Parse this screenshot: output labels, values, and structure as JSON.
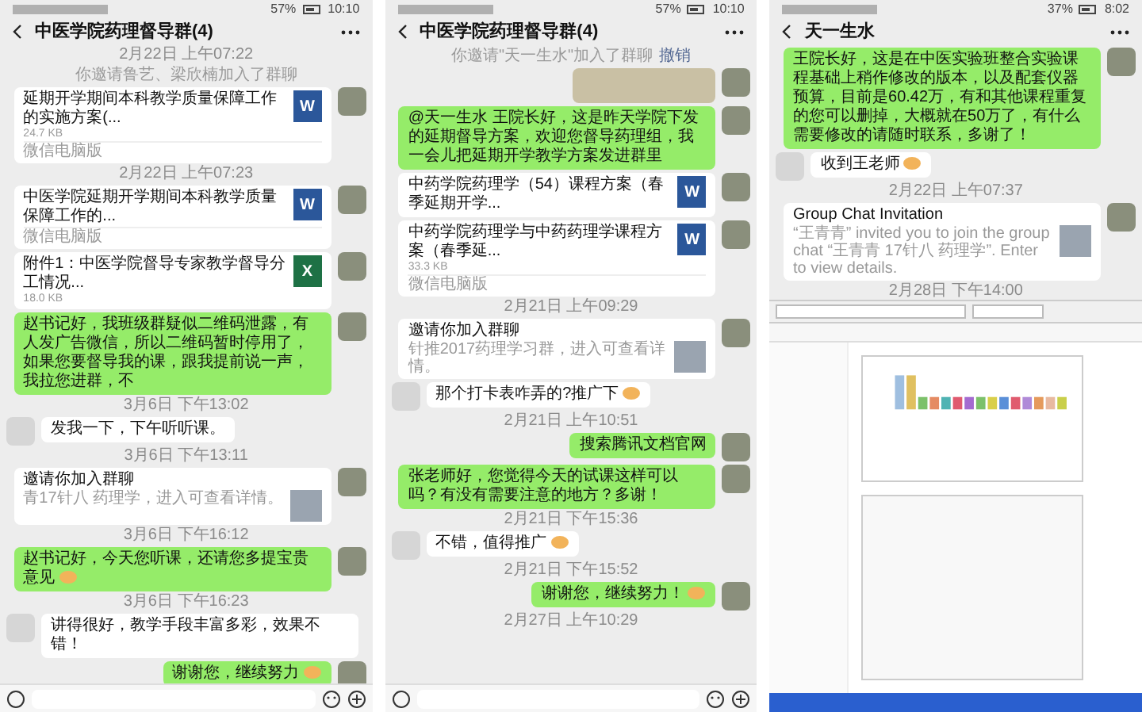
{
  "phones": [
    {
      "status_bar": {
        "battery": "57%",
        "time": "10:10"
      },
      "title": "中医学院药理督导群(4)",
      "messages": [
        {
          "kind": "time",
          "text": "2月22日 上午07:22"
        },
        {
          "kind": "system",
          "text": "你邀请鲁艺、梁欣楠加入了群聊"
        },
        {
          "kind": "file",
          "outgoing": true,
          "name": "延期开学期间本科教学质量保障工作的实施方案(...",
          "size": "24.7 KB",
          "source": "微信电脑版",
          "color": "#2b579a",
          "icon_letter": "W"
        },
        {
          "kind": "time",
          "text": "2月22日 上午07:23"
        },
        {
          "kind": "file",
          "outgoing": true,
          "name": "中医学院延期开学期间本科教学质量保障工作的...",
          "source": "微信电脑版",
          "color": "#2b579a",
          "icon_letter": "W"
        },
        {
          "kind": "file",
          "outgoing": true,
          "name": "附件1：中医学院督导专家教学督导分工情况...",
          "size": "18.0 KB",
          "color": "#1e7145",
          "icon_letter": "X"
        },
        {
          "kind": "text",
          "outgoing": true,
          "text": "赵书记好，我班级群疑似二维码泄露，有人发广告微信，所以二维码暂时停用了，如果您要督导我的课，跟我提前说一声，我拉您进群，不",
          "emoji": false
        },
        {
          "kind": "time",
          "text": "3月6日 下午13:02"
        },
        {
          "kind": "text",
          "outgoing": false,
          "text": "发我一下，下午听听课。",
          "emoji": false
        },
        {
          "kind": "time",
          "text": "3月6日 下午13:11"
        },
        {
          "kind": "invite",
          "outgoing": true,
          "title": "邀请你加入群聊",
          "desc": "青17针八 药理学，进入可查看详情。"
        },
        {
          "kind": "time",
          "text": "3月6日 下午16:12"
        },
        {
          "kind": "text",
          "outgoing": true,
          "text": "赵书记好，今天您听课，还请您多提宝贵意见",
          "emoji": true
        },
        {
          "kind": "time",
          "text": "3月6日 下午16:23"
        },
        {
          "kind": "text",
          "outgoing": false,
          "text": "讲得很好，教学手段丰富多彩，效果不错！",
          "emoji": false
        },
        {
          "kind": "text",
          "outgoing": true,
          "text": "谢谢您，继续努力",
          "emoji": true
        }
      ]
    },
    {
      "status_bar": {
        "battery": "57%",
        "time": "10:10"
      },
      "title": "中医学院药理督导群(4)",
      "messages": [
        {
          "kind": "system",
          "text": "你邀请\"天一生水\"加入了群聊",
          "link": "撤销"
        },
        {
          "kind": "image",
          "outgoing": true
        },
        {
          "kind": "text",
          "outgoing": true,
          "text": "@天一生水 王院长好，这是昨天学院下发的延期督导方案，欢迎您督导药理组，我一会儿把延期开学教学方案发进群里",
          "emoji": false
        },
        {
          "kind": "file",
          "outgoing": true,
          "name": "中药学院药理学（54）课程方案（春季延期开学...",
          "color": "#2b579a",
          "icon_letter": "W"
        },
        {
          "kind": "file",
          "outgoing": true,
          "name": "中药学院药理学与中药药理学课程方案（春季延...",
          "size": "33.3 KB",
          "source": "微信电脑版",
          "color": "#2b579a",
          "icon_letter": "W"
        },
        {
          "kind": "time",
          "text": "2月21日 上午09:29"
        },
        {
          "kind": "invite",
          "outgoing": true,
          "title": "邀请你加入群聊",
          "desc": "针推2017药理学习群，进入可查看详情。"
        },
        {
          "kind": "text",
          "outgoing": false,
          "text": "那个打卡表咋弄的?推广下",
          "emoji": true
        },
        {
          "kind": "time",
          "text": "2月21日 上午10:51"
        },
        {
          "kind": "text",
          "outgoing": true,
          "text": "搜索腾讯文档官网",
          "emoji": false
        },
        {
          "kind": "text",
          "outgoing": true,
          "text": "张老师好，您觉得今天的试课这样可以吗？有没有需要注意的地方？多谢！",
          "emoji": false
        },
        {
          "kind": "time",
          "text": "2月21日 下午15:36"
        },
        {
          "kind": "text",
          "outgoing": false,
          "text": "不错，值得推广",
          "emoji": true
        },
        {
          "kind": "time",
          "text": "2月21日 下午15:52"
        },
        {
          "kind": "text",
          "outgoing": true,
          "text": "谢谢您，继续努力！",
          "emoji": true
        },
        {
          "kind": "time",
          "text": "2月27日 上午10:29"
        }
      ]
    },
    {
      "status_bar": {
        "battery": "37%",
        "time": "8:02"
      },
      "title": "天一生水",
      "messages": [
        {
          "kind": "text",
          "outgoing": true,
          "text": "王院长好，这是在中医实验班整合实验课程基础上稍作修改的版本，以及配套仪器预算，目前是60.42万，有和其他课程重复的您可以删掉，大概就在50万了，有什么需要修改的请随时联系，多谢了！",
          "emoji": false
        },
        {
          "kind": "text",
          "outgoing": false,
          "text": "收到王老师",
          "emoji": true
        },
        {
          "kind": "time",
          "text": "2月22日 上午07:37"
        },
        {
          "kind": "invite",
          "outgoing": true,
          "title": "Group Chat Invitation",
          "desc": "“王青青” invited you to join the group chat “王青青 17针八 药理学”. Enter to view details."
        },
        {
          "kind": "time",
          "text": "2月28日 下午14:00"
        }
      ],
      "browser_overlay": true
    }
  ]
}
